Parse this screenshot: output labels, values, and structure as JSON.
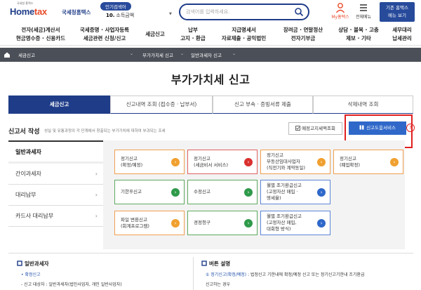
{
  "header": {
    "logo_tagline": "국세청 홈택스",
    "logo_name": "Hometax",
    "logo_name_home": "Home",
    "logo_name_tax": "tax",
    "logo_kor": "국세청홈택스",
    "popular_badge": "인기검색어",
    "popular_rank": "10.",
    "popular_term": "소득금액",
    "search_placeholder": "검색어를 입력하세요.",
    "my_hometax": "My홈택스",
    "all_menu": "전체메뉴",
    "prev_hometax_line1": "기존 홈택스",
    "prev_hometax_line2": "메뉴 보기"
  },
  "nav": [
    {
      "l1": "전자(세금)계산서",
      "l2": "현금영수증 · 신용카드"
    },
    {
      "l1": "국세증명 · 사업자등록",
      "l2": "세금관련 신청/신고"
    },
    {
      "l1": "세금신고",
      "l2": ""
    },
    {
      "l1": "납부",
      "l2": "고지 · 환급"
    },
    {
      "l1": "지급명세서",
      "l2": "자료제출 · 공익법인"
    },
    {
      "l1": "장려금 · 연말정산",
      "l2": "전자기부금"
    },
    {
      "l1": "상담 · 불복 · 고충",
      "l2": "제보 · 기타"
    },
    {
      "l1": "세무대리",
      "l2": "납세관리"
    }
  ],
  "breadcrumb": [
    "세금신고",
    "부가가치세 신고",
    "일반과세자 신고"
  ],
  "page_title": "부가가치세 신고",
  "tabs": [
    "세금신고",
    "신고내역 조회 (접수증 · 납부서)",
    "신고 부속 · 증빙서류 제출",
    "삭제내역 조회"
  ],
  "section": {
    "title": "신고서 작성",
    "desc": "성실 및 유통과정의 각 단계에서 창출되는 부가가치에 대하여 부과되는 조세",
    "prefill_button": "예정고지세액조회",
    "help_button": "신고도움서비스",
    "help_q": "?"
  },
  "sidebar": [
    "일반과세자",
    "간이과세자",
    "대리납부",
    "카드사 대리납부"
  ],
  "grid": [
    {
      "lines": [
        "정기신고",
        "(확정/예정)"
      ],
      "color": "orange"
    },
    {
      "lines": [
        "정기신고",
        "(세금비서 서비스)"
      ],
      "color": "red"
    },
    {
      "lines": [
        "정기신고",
        "부동산임대사업자",
        "(직전기와 계약동일)"
      ],
      "color": "orange"
    },
    {
      "lines": [
        "정기신고",
        "(폐업확정)"
      ],
      "color": "orange"
    },
    {
      "lines": [
        "기한후신고"
      ],
      "color": "green"
    },
    {
      "lines": [
        "수정신고"
      ],
      "color": "green"
    },
    {
      "lines": [
        "월별 조기환급신고",
        "(고정자산 매입 ·",
        "영세율)"
      ],
      "color": "blue"
    },
    {
      "lines": [
        "파일 변환신고",
        "(회계프로그램)"
      ],
      "color": "orange"
    },
    {
      "lines": [
        "경정청구"
      ],
      "color": "green"
    },
    {
      "lines": [
        "월별 조기환급신고",
        "(고정자산 매입,",
        "대회형 방식)"
      ],
      "color": "blue"
    }
  ],
  "info": {
    "left_title": "일반과세자",
    "left_line1": "• 확정신고",
    "left_line2": "- 신고 대상자 : 일반과세자(법인사업자, 개인 일반사업자)",
    "right_title": "버튼 설명",
    "right_line1_blue": "① 정기신고(확정/예정)",
    "right_line1_rest": " : 법정신고 기한내에 확정/예정 신고 또는 정기신고기한내 조기환급",
    "right_line2": "신고하는 경우"
  },
  "colors": {
    "brand": "#1f3c88",
    "active_tab": "#1f3c88",
    "help_button": "#2f68c9",
    "highlight_frame": "#e02020",
    "breadcrumb_bar": "#4b4f58"
  }
}
